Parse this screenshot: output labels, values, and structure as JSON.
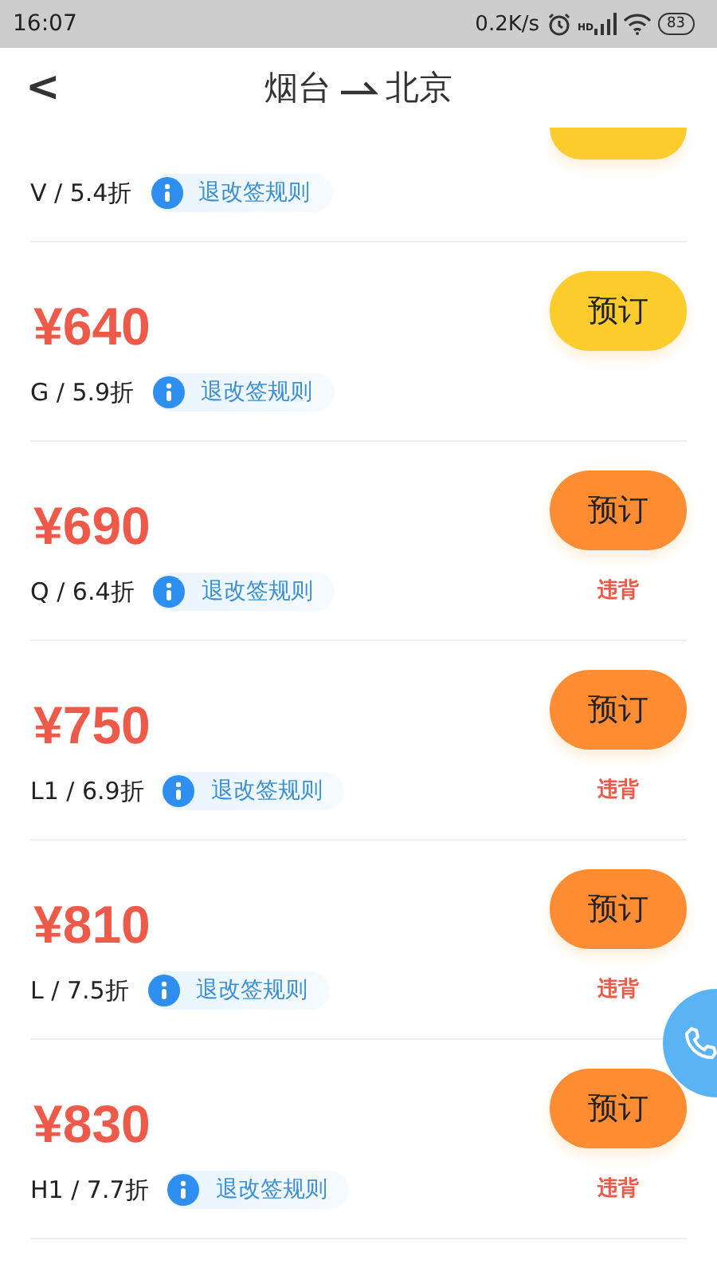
{
  "status_bar": {
    "time": "16:07",
    "speed": "0.2K/s",
    "signal_label": "HD",
    "battery": "83"
  },
  "header": {
    "back": "<",
    "from": "烟台",
    "to": "北京"
  },
  "fares": [
    {
      "kind": "partial",
      "class_discount": "V / 5.4折",
      "rules": "退改签规则",
      "color": "#fccb2c"
    },
    {
      "kind": "full",
      "price": "¥640",
      "class_discount": "G / 5.9折",
      "rules": "退改签规则",
      "button": "预订",
      "color": "#fccb2c"
    },
    {
      "kind": "full",
      "price": "¥690",
      "class_discount": "Q / 6.4折",
      "rules": "退改签规则",
      "button": "预订",
      "color": "#fd8c32",
      "warning": "违背"
    },
    {
      "kind": "full",
      "price": "¥750",
      "class_discount": "L1 / 6.9折",
      "rules": "退改签规则",
      "button": "预订",
      "color": "#fd8c32",
      "warning": "违背"
    },
    {
      "kind": "full",
      "price": "¥810",
      "class_discount": "L / 7.5折",
      "rules": "退改签规则",
      "button": "预订",
      "color": "#fd8c32",
      "warning": "违背"
    },
    {
      "kind": "full",
      "price": "¥830",
      "class_discount": "H1 / 7.7折",
      "rules": "退改签规则",
      "button": "预订",
      "color": "#fd8c32",
      "warning": "违背"
    }
  ]
}
